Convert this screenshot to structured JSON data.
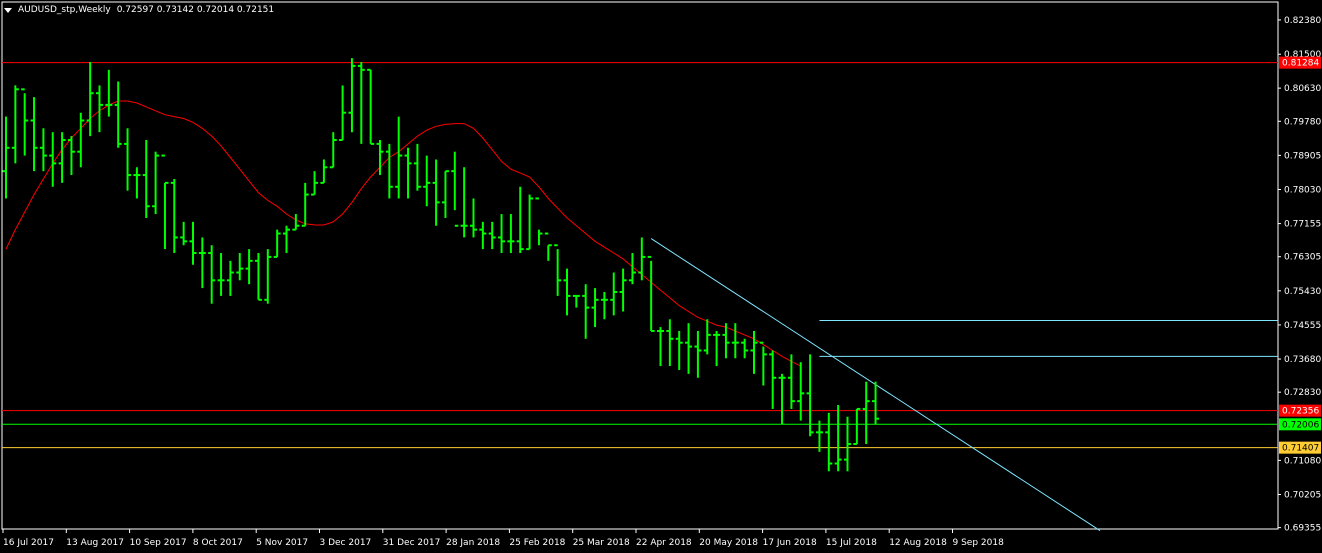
{
  "header": {
    "symbol_timeframe": "AUDUSD_stp,Weekly",
    "ohlc": "0.72597 0.73142 0.72014 0.72151"
  },
  "colors": {
    "background": "#000000",
    "bar": "#00ff00",
    "ma": "#ff0000",
    "trendline": "#7fe6ff",
    "resistance": "#ff0000",
    "current_price": "#00ff00",
    "support": "#ffcc33",
    "axis_text": "#ffffff"
  },
  "chart_data": {
    "type": "ohlc",
    "price_ticks": [
      "0.82380",
      "0.81500",
      "0.80630",
      "0.79780",
      "0.78905",
      "0.78030",
      "0.77155",
      "0.76305",
      "0.75430",
      "0.74555",
      "0.73680",
      "0.72830",
      "0.71080",
      "0.70205",
      "0.69355"
    ],
    "time_labels": [
      "16 Jul 2017",
      "13 Aug 2017",
      "10 Sep 2017",
      "8 Oct 2017",
      "5 Nov 2017",
      "3 Dec 2017",
      "31 Dec 2017",
      "28 Jan 2018",
      "25 Feb 2018",
      "25 Mar 2018",
      "22 Apr 2018",
      "20 May 2018",
      "17 Jun 2018",
      "15 Jul 2018",
      "12 Aug 2018",
      "9 Sep 2018"
    ],
    "ylim": [
      0.6932,
      0.8284
    ],
    "bars": [
      [
        0.785,
        0.799,
        0.778,
        0.791
      ],
      [
        0.791,
        0.807,
        0.787,
        0.806
      ],
      [
        0.806,
        0.805,
        0.789,
        0.798
      ],
      [
        0.798,
        0.804,
        0.785,
        0.791
      ],
      [
        0.791,
        0.796,
        0.785,
        0.789
      ],
      [
        0.789,
        0.795,
        0.781,
        0.787
      ],
      [
        0.787,
        0.795,
        0.782,
        0.793
      ],
      [
        0.793,
        0.794,
        0.784,
        0.79
      ],
      [
        0.79,
        0.8,
        0.786,
        0.798
      ],
      [
        0.798,
        0.813,
        0.794,
        0.805
      ],
      [
        0.805,
        0.807,
        0.795,
        0.802
      ],
      [
        0.802,
        0.811,
        0.799,
        0.802
      ],
      [
        0.802,
        0.808,
        0.791,
        0.792
      ],
      [
        0.792,
        0.796,
        0.78,
        0.784
      ],
      [
        0.784,
        0.786,
        0.778,
        0.784
      ],
      [
        0.784,
        0.793,
        0.773,
        0.776
      ],
      [
        0.776,
        0.79,
        0.774,
        0.789
      ],
      [
        0.789,
        0.782,
        0.765,
        0.782
      ],
      [
        0.782,
        0.783,
        0.764,
        0.768
      ],
      [
        0.768,
        0.772,
        0.766,
        0.767
      ],
      [
        0.767,
        0.772,
        0.761,
        0.764
      ],
      [
        0.764,
        0.768,
        0.755,
        0.764
      ],
      [
        0.764,
        0.766,
        0.751,
        0.757
      ],
      [
        0.757,
        0.764,
        0.753,
        0.757
      ],
      [
        0.757,
        0.762,
        0.753,
        0.759
      ],
      [
        0.759,
        0.764,
        0.757,
        0.76
      ],
      [
        0.76,
        0.765,
        0.756,
        0.762
      ],
      [
        0.762,
        0.764,
        0.752,
        0.752
      ],
      [
        0.752,
        0.765,
        0.751,
        0.763
      ],
      [
        0.763,
        0.77,
        0.763,
        0.769
      ],
      [
        0.769,
        0.771,
        0.764,
        0.77
      ],
      [
        0.77,
        0.774,
        0.77,
        0.771
      ],
      [
        0.771,
        0.782,
        0.771,
        0.779
      ],
      [
        0.779,
        0.785,
        0.779,
        0.782
      ],
      [
        0.782,
        0.788,
        0.782,
        0.786
      ],
      [
        0.786,
        0.795,
        0.786,
        0.793
      ],
      [
        0.793,
        0.807,
        0.793,
        0.8
      ],
      [
        0.8,
        0.814,
        0.795,
        0.812
      ],
      [
        0.812,
        0.813,
        0.792,
        0.811
      ],
      [
        0.811,
        0.811,
        0.792,
        0.792
      ],
      [
        0.792,
        0.793,
        0.784,
        0.79
      ],
      [
        0.79,
        0.792,
        0.778,
        0.781
      ],
      [
        0.781,
        0.799,
        0.778,
        0.789
      ],
      [
        0.789,
        0.791,
        0.778,
        0.787
      ],
      [
        0.787,
        0.792,
        0.78,
        0.781
      ],
      [
        0.781,
        0.789,
        0.776,
        0.782
      ],
      [
        0.782,
        0.788,
        0.771,
        0.777
      ],
      [
        0.777,
        0.785,
        0.773,
        0.785
      ],
      [
        0.785,
        0.79,
        0.775,
        0.771
      ],
      [
        0.771,
        0.786,
        0.768,
        0.771
      ],
      [
        0.771,
        0.778,
        0.768,
        0.77
      ],
      [
        0.77,
        0.772,
        0.765,
        0.769
      ],
      [
        0.769,
        0.772,
        0.765,
        0.768
      ],
      [
        0.768,
        0.774,
        0.764,
        0.767
      ],
      [
        0.767,
        0.774,
        0.764,
        0.767
      ],
      [
        0.767,
        0.781,
        0.764,
        0.765
      ],
      [
        0.765,
        0.779,
        0.765,
        0.778
      ],
      [
        0.778,
        0.77,
        0.766,
        0.769
      ],
      [
        0.769,
        0.766,
        0.762,
        0.766
      ],
      [
        0.766,
        0.765,
        0.753,
        0.757
      ],
      [
        0.757,
        0.76,
        0.748,
        0.753
      ],
      [
        0.753,
        0.753,
        0.75,
        0.753
      ],
      [
        0.753,
        0.756,
        0.742,
        0.75
      ],
      [
        0.75,
        0.755,
        0.745,
        0.752
      ],
      [
        0.752,
        0.754,
        0.747,
        0.752
      ],
      [
        0.752,
        0.759,
        0.748,
        0.754
      ],
      [
        0.754,
        0.76,
        0.749,
        0.757
      ],
      [
        0.757,
        0.764,
        0.756,
        0.759
      ],
      [
        0.759,
        0.768,
        0.757,
        0.763
      ],
      [
        0.763,
        0.762,
        0.744,
        0.744
      ],
      [
        0.744,
        0.745,
        0.735,
        0.744
      ],
      [
        0.744,
        0.747,
        0.735,
        0.742
      ],
      [
        0.742,
        0.744,
        0.734,
        0.741
      ],
      [
        0.741,
        0.746,
        0.733,
        0.74
      ],
      [
        0.74,
        0.744,
        0.732,
        0.739
      ],
      [
        0.739,
        0.747,
        0.738,
        0.743
      ],
      [
        0.743,
        0.744,
        0.735,
        0.743
      ],
      [
        0.743,
        0.746,
        0.737,
        0.741
      ],
      [
        0.741,
        0.746,
        0.737,
        0.741
      ],
      [
        0.741,
        0.742,
        0.737,
        0.739
      ],
      [
        0.739,
        0.744,
        0.733,
        0.741
      ],
      [
        0.741,
        0.74,
        0.73,
        0.738
      ],
      [
        0.738,
        0.739,
        0.724,
        0.732
      ],
      [
        0.732,
        0.733,
        0.72,
        0.732
      ],
      [
        0.732,
        0.738,
        0.724,
        0.726
      ],
      [
        0.726,
        0.736,
        0.721,
        0.728
      ],
      [
        0.728,
        0.738,
        0.717,
        0.718
      ],
      [
        0.718,
        0.721,
        0.713,
        0.718
      ],
      [
        0.718,
        0.723,
        0.708,
        0.71
      ],
      [
        0.71,
        0.725,
        0.708,
        0.711
      ],
      [
        0.711,
        0.722,
        0.708,
        0.715
      ],
      [
        0.715,
        0.724,
        0.715,
        0.724
      ],
      [
        0.724,
        0.731,
        0.715,
        0.726
      ],
      [
        0.726,
        0.731,
        0.72,
        0.7215
      ]
    ],
    "ma": [
      0.765,
      0.77,
      0.7745,
      0.779,
      0.783,
      0.787,
      0.7905,
      0.7935,
      0.796,
      0.7985,
      0.8005,
      0.802,
      0.803,
      0.803,
      0.8025,
      0.8015,
      0.8005,
      0.7995,
      0.799,
      0.7985,
      0.7975,
      0.796,
      0.794,
      0.7915,
      0.7885,
      0.7855,
      0.7825,
      0.7795,
      0.7775,
      0.776,
      0.774,
      0.7725,
      0.7715,
      0.7712,
      0.7712,
      0.772,
      0.774,
      0.777,
      0.7805,
      0.7835,
      0.786,
      0.7885,
      0.79,
      0.792,
      0.794,
      0.7955,
      0.7965,
      0.797,
      0.7972,
      0.7972,
      0.796,
      0.7935,
      0.7905,
      0.7875,
      0.7855,
      0.7845,
      0.7835,
      0.781,
      0.778,
      0.7755,
      0.773,
      0.771,
      0.769,
      0.767,
      0.7655,
      0.764,
      0.7625,
      0.7605,
      0.7585,
      0.7565,
      0.7545,
      0.7525,
      0.7505,
      0.749,
      0.7475,
      0.7465,
      0.7455,
      0.745,
      0.744,
      0.743,
      0.742,
      0.7405,
      0.739,
      0.7375,
      0.7362,
      0.735
    ],
    "levels": {
      "resistance": {
        "value": 0.81284,
        "label": "0.81284"
      },
      "current": {
        "value": 0.72006,
        "label": "0.72006"
      },
      "red_line": {
        "value": 0.72356,
        "label": "0.72356"
      },
      "support": {
        "value": 0.71407,
        "label": "0.71407"
      },
      "cyan_h1": 0.7467,
      "cyan_h2": 0.7375
    },
    "trendline": {
      "from": [
        69,
        0.7677
      ],
      "to": [
        117,
        0.6928
      ]
    },
    "grid": false
  }
}
